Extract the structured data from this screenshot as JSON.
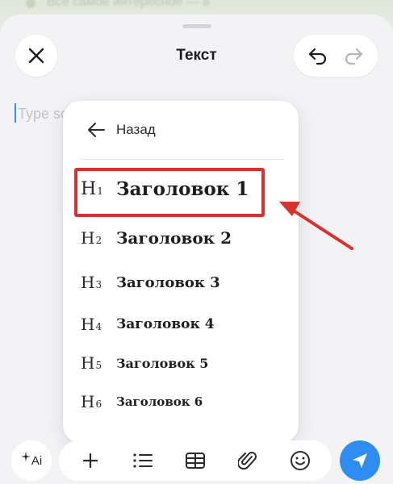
{
  "backdrop": {
    "text": "Всё самое интересное — в"
  },
  "header": {
    "title": "Текст"
  },
  "editor": {
    "placeholder": "Type something"
  },
  "menu": {
    "back_label": "Назад",
    "items": [
      {
        "glyph": "H",
        "num": "1",
        "label": "Заголовок 1",
        "font_size": 24
      },
      {
        "glyph": "H",
        "num": "2",
        "label": "Заголовок 2",
        "font_size": 21
      },
      {
        "glyph": "H",
        "num": "3",
        "label": "Заголовок 3",
        "font_size": 19
      },
      {
        "glyph": "H",
        "num": "4",
        "label": "Заголовок 4",
        "font_size": 18
      },
      {
        "glyph": "H",
        "num": "5",
        "label": "Заголовок 5",
        "font_size": 17
      },
      {
        "glyph": "H",
        "num": "6",
        "label": "Заголовок 6",
        "font_size": 16
      }
    ],
    "highlighted_item": "Заголовок 1"
  },
  "toolbar": {
    "ai_label": "Ai",
    "buttons": [
      "plus-icon",
      "list-icon",
      "table-icon",
      "attachment-icon",
      "emoji-icon"
    ]
  },
  "colors": {
    "accent": "#2f8cf0",
    "annotation_red": "#d9312b",
    "sheet_bg": "#f3f3f5"
  }
}
